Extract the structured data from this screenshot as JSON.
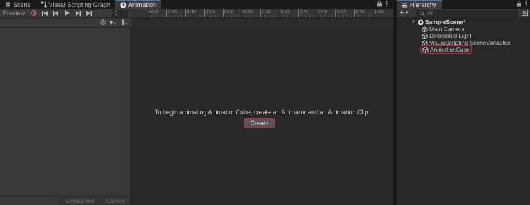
{
  "tabs_left": {
    "scene": {
      "label": "Scene",
      "icon": "hash-icon"
    },
    "visual_scripting": {
      "label": "Visual Scripting Graph",
      "icon": "graph-icon"
    },
    "animation": {
      "label": "Animation",
      "icon": "animation-clock-icon"
    }
  },
  "tabs_right": {
    "hierarchy": {
      "label": "Hierarchy",
      "icon": "list-icon"
    }
  },
  "animation": {
    "toolbar": {
      "preview_label": "Preview",
      "frame_value": "0"
    },
    "ruler_labels": [
      "0:00",
      "0:05",
      "0:10",
      "0:15",
      "0:20",
      "0:25",
      "0:30",
      "0:35",
      "0:40",
      "0:45",
      "0:50",
      "0:55",
      "1:00"
    ],
    "message": "To begin animating AnimationCube, create an Animator and an Animation Clip.",
    "create_label": "Create",
    "modes": {
      "dopesheet": "Dopesheet",
      "curves": "Curves"
    }
  },
  "hierarchy": {
    "search_placeholder": "All",
    "scene_name": "SampleScene*",
    "items": [
      {
        "label": "Main Camera"
      },
      {
        "label": "Directional Light"
      },
      {
        "label": "VisualScripting SceneVariables"
      },
      {
        "label": "AnimationCube"
      }
    ]
  },
  "colors": {
    "accent_tab": "#3a79bb",
    "highlight": "#e21d2b",
    "record": "#e05353"
  }
}
